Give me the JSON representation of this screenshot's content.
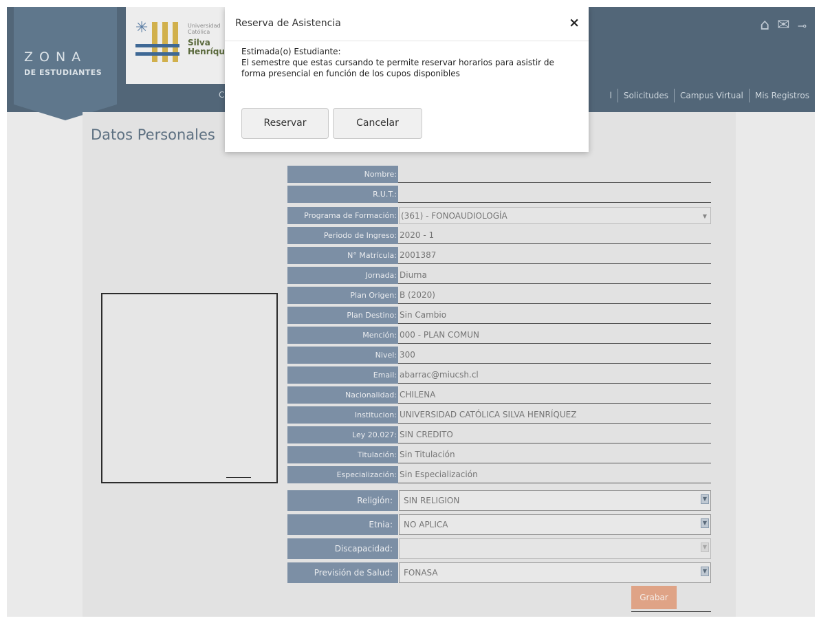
{
  "header": {
    "zona_title": "ZONA",
    "zona_subtitle": "DE ESTUDIANTES",
    "logo_small": "Universidad Católica",
    "logo_big": "Silva Henríqu",
    "icons": [
      "home-icon",
      "mail-icon",
      "key-icon"
    ],
    "nav_partial": "C",
    "nav_items": [
      "l",
      "Solicitudes",
      "Campus Virtual",
      "Mis Registros"
    ]
  },
  "page": {
    "title": "Datos Personales",
    "fields": [
      {
        "label": "Nombre:",
        "value": ""
      },
      {
        "label": "R.U.T.:",
        "value": ""
      },
      {
        "label": "Programa de Formación:",
        "value": "(361) - FONOAUDIOLOGÍA",
        "type": "select"
      },
      {
        "label": "Periodo de Ingreso:",
        "value": "2020 - 1"
      },
      {
        "label": "N° Matrícula:",
        "value": "2001387"
      },
      {
        "label": "Jornada:",
        "value": "Diurna"
      },
      {
        "label": "Plan Origen:",
        "value": "B (2020)"
      },
      {
        "label": "Plan Destino:",
        "value": "Sin Cambio"
      },
      {
        "label": "Mención:",
        "value": "000 - PLAN COMUN"
      },
      {
        "label": "Nivel:",
        "value": "300"
      },
      {
        "label": "Email:",
        "value": "abarrac@miucsh.cl"
      },
      {
        "label": "Nacionalidad:",
        "value": "CHILENA"
      },
      {
        "label": "Institucion:",
        "value": "UNIVERSIDAD CATÓLICA SILVA HENRÍQUEZ"
      },
      {
        "label": "Ley 20.027:",
        "value": "SIN CREDITO"
      },
      {
        "label": "Titulación:",
        "value": "Sin Titulación"
      },
      {
        "label": "Especialización:",
        "value": "Sin Especialización"
      }
    ],
    "selects": [
      {
        "label": "Religión:",
        "value": "SIN RELIGION"
      },
      {
        "label": "Etnia:",
        "value": "NO APLICA"
      },
      {
        "label": "Discapacidad:",
        "value": ""
      },
      {
        "label": "Previsión de Salud:",
        "value": "FONASA"
      }
    ],
    "save_label": "Grabar"
  },
  "modal": {
    "title": "Reserva de Asistencia",
    "close": "×",
    "greeting": "Estimada(o) Estudiante:",
    "message": "El semestre que estas cursando te permite reservar horarios para asistir de forma presencial en función de los cupos disponibles",
    "reserve_label": "Reservar",
    "cancel_label": "Cancelar"
  }
}
